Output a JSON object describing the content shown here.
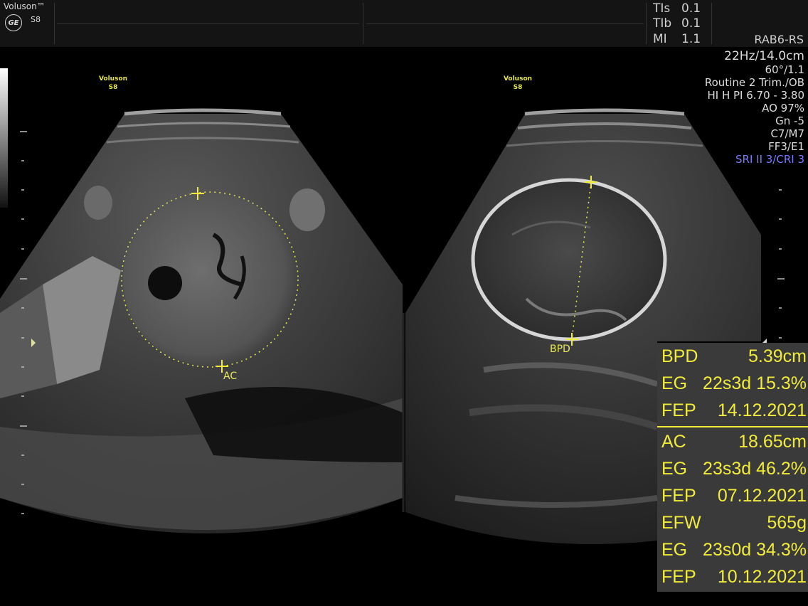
{
  "header": {
    "brand": "Voluson™",
    "logo": "GE",
    "model": "S8",
    "safety": [
      {
        "key": "TIs",
        "value": "0.1"
      },
      {
        "key": "TIb",
        "value": "0.1"
      },
      {
        "key": "MI",
        "value": "1.1"
      }
    ],
    "probe": "RAB6-RS"
  },
  "params": {
    "frame_depth": "22Hz/14.0cm",
    "angle": "60°/1.1",
    "preset": "Routine 2 Trim./OB",
    "harmonics": "HI H PI 6.70 - 3.80",
    "acoustic_output": "AO 97%",
    "gain": "Gn  -5",
    "map": "C7/M7",
    "filter": "FF3/E1",
    "sri": "SRI II 3/CRI 3"
  },
  "image_tags": {
    "left": {
      "line1": "Voluson",
      "line2": "S8"
    },
    "right": {
      "line1": "Voluson",
      "line2": "S8"
    }
  },
  "labels": {
    "ac": "AC",
    "bpd": "BPD"
  },
  "results": {
    "bpd": [
      {
        "label": "BPD",
        "value": "5.39cm"
      },
      {
        "label": "EG",
        "value": "22s3d 15.3%"
      },
      {
        "label": "FEP",
        "value": "14.12.2021"
      }
    ],
    "ac": [
      {
        "label": "AC",
        "value": "18.65cm"
      },
      {
        "label": "EG",
        "value": "23s3d 46.2%"
      },
      {
        "label": "FEP",
        "value": "07.12.2021"
      },
      {
        "label": "EFW",
        "value": "565g"
      },
      {
        "label": "EG",
        "value": "23s0d 34.3%"
      },
      {
        "label": "FEP",
        "value": "10.12.2021"
      }
    ]
  },
  "colors": {
    "measure": "#f1eb3a",
    "sri": "#7a7aff",
    "panel": "#3a3a3a"
  }
}
